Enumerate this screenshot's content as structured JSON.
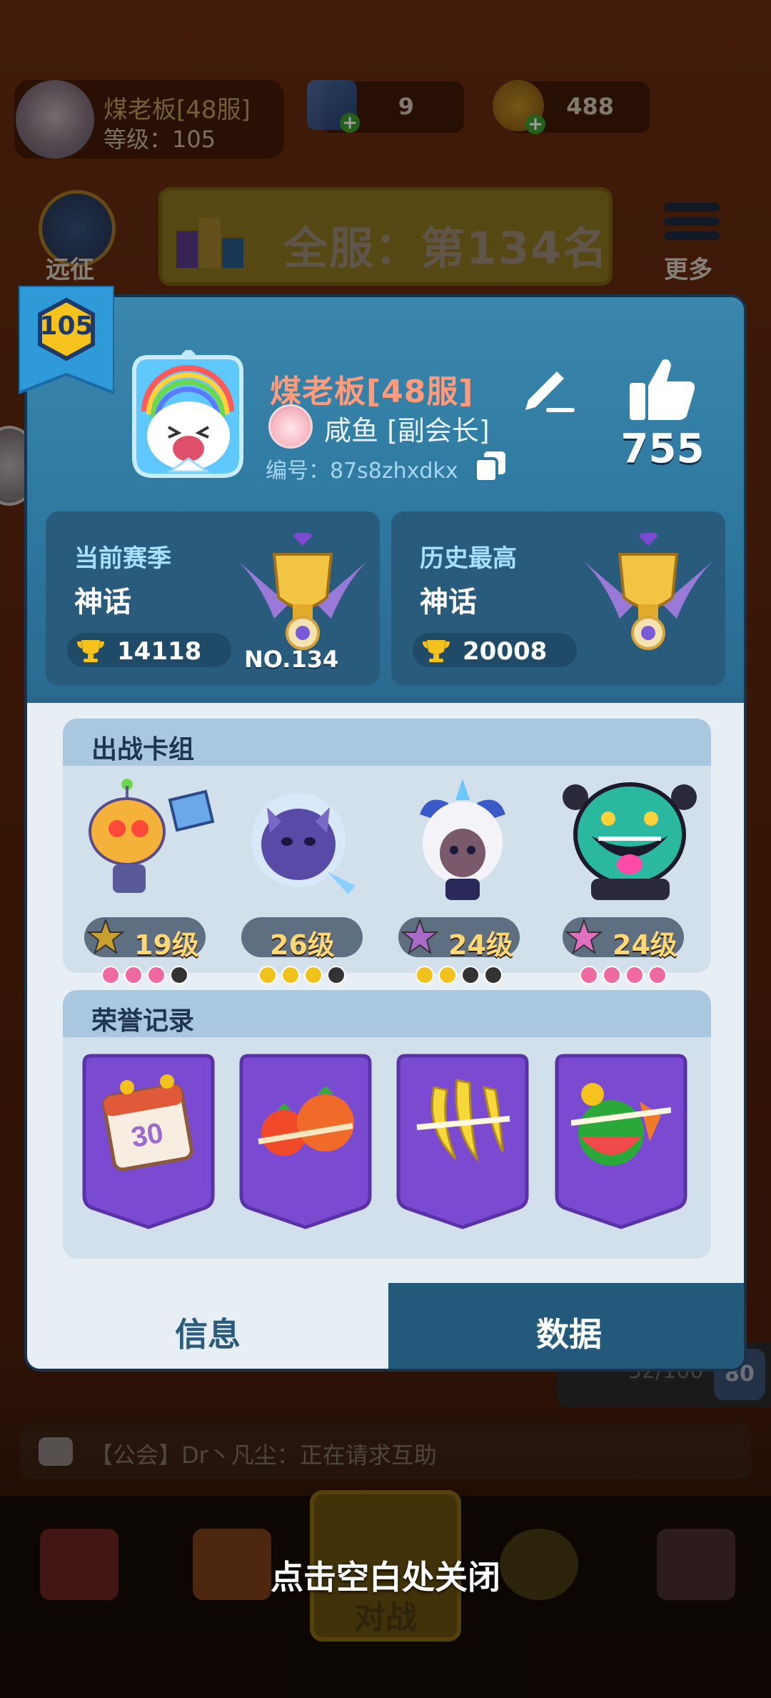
{
  "background": {
    "player_name": "煤老板[48服]",
    "player_level": "等级：105",
    "gems": "9",
    "coins": "488",
    "expedition_label": "远征",
    "server_rank": "全服：第134名",
    "more_label": "更多",
    "progress_text": "52/100",
    "progress_badge": "80",
    "chat_message": "【公会】Dr丶凡尘：正在请求互助",
    "battle_label": "对战"
  },
  "close_hint": "点击空白处关闭",
  "profile": {
    "level_badge": "105",
    "name": "煤老板[48服]",
    "guild": "咸鱼 [副会长]",
    "player_id": "编号：87s8zhxdkx",
    "likes": "755"
  },
  "current_season": {
    "title": "当前赛季",
    "tier": "神话",
    "score": "14118",
    "rank": "NO.134"
  },
  "historic_best": {
    "title": "历史最高",
    "tier": "神话",
    "score": "20008"
  },
  "deck": {
    "title": "出战卡组",
    "units": [
      {
        "level": "19级",
        "star_color": "#c9a030",
        "dots": [
          "#f06aa0",
          "#f06aa0",
          "#f06aa0",
          "#333333"
        ]
      },
      {
        "level": "26级",
        "star_color": "#c9a030",
        "dots": [
          "#f2c21c",
          "#f2c21c",
          "#f2c21c",
          "#333333"
        ]
      },
      {
        "level": "24级",
        "star_color": "#a86bc8",
        "dots": [
          "#f2c21c",
          "#f2c21c",
          "#333333",
          "#333333"
        ]
      },
      {
        "level": "24级",
        "star_color": "#e070c0",
        "dots": [
          "#f06aa0",
          "#f06aa0",
          "#f06aa0",
          "#f06aa0"
        ]
      }
    ]
  },
  "honor": {
    "title": "荣誉记录",
    "badges": [
      {
        "icon": "calendar-30-icon",
        "text": "30"
      },
      {
        "icon": "tomatoes-icon"
      },
      {
        "icon": "banana-icon"
      },
      {
        "icon": "watermelon-icon"
      }
    ]
  },
  "tabs": {
    "info": "信息",
    "data": "数据"
  },
  "colors": {
    "card_blue": "#2e79a0",
    "name_color": "#ff9a7a",
    "level_gold": "#ffd774",
    "honor_purple": "#7a4ad0"
  }
}
